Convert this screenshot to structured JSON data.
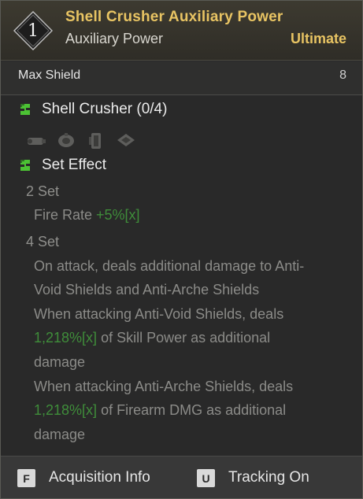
{
  "header": {
    "tier": "1",
    "title": "Shell Crusher Auxiliary Power",
    "subtitle": "Auxiliary Power",
    "grade": "Ultimate"
  },
  "stat": {
    "name": "Max Shield",
    "value": "8"
  },
  "set_name": {
    "icon": "set-bonus-icon",
    "label": "Shell Crusher (0/4)"
  },
  "set_parts": [
    {
      "icon": "part-1-icon"
    },
    {
      "icon": "part-2-icon"
    },
    {
      "icon": "part-3-icon"
    },
    {
      "icon": "part-4-icon"
    }
  ],
  "set_effect": {
    "icon": "set-effect-icon",
    "label": "Set Effect",
    "two_set": {
      "label": "2 Set",
      "prefix": "Fire Rate ",
      "value": "+5%[x]"
    },
    "four_set": {
      "label": "4 Set",
      "line1": "On attack, deals additional damage to Anti-",
      "line2": "Void Shields and Anti-Arche Shields",
      "line3": "When attacking Anti-Void Shields, deals",
      "line4_value": "1,218%[x]",
      "line4_rest": " of Skill Power as additional",
      "line5": "damage",
      "line6": "When attacking Anti-Arche Shields, deals",
      "line7_value": "1,218%[x]",
      "line7_rest": " of Firearm DMG as additional",
      "line8": "damage"
    }
  },
  "footer": {
    "acquisition_key": "F",
    "acquisition_label": "Acquisition Info",
    "tracking_key": "U",
    "tracking_label": "Tracking On"
  },
  "colors": {
    "title_gold": "#e8c463",
    "value_green": "#3f8d3a",
    "icon_green": "#4cc234"
  }
}
